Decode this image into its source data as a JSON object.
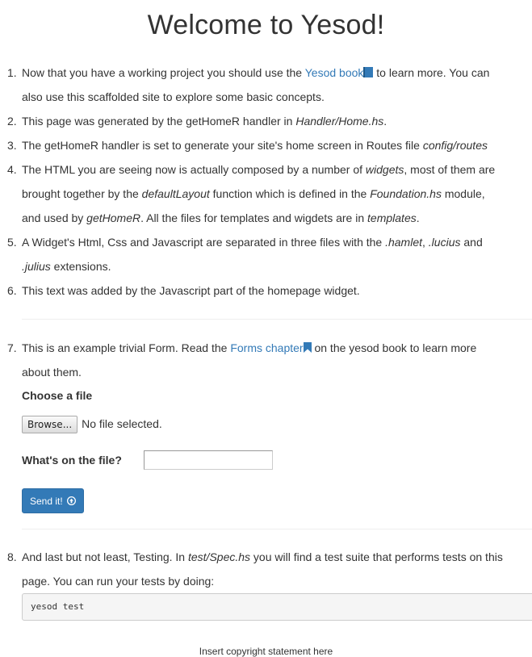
{
  "title": "Welcome to Yesod!",
  "items": [
    {
      "num": "1.",
      "t1": "Now that you have a working project you should use the ",
      "link": "Yesod book",
      "t2": " to learn more. You can",
      "t3": "also use this scaffolded site to explore some basic concepts."
    },
    {
      "num": "2.",
      "t1": "This page was generated by the getHomeR handler in ",
      "em1": "Handler/Home.hs",
      "t2": "."
    },
    {
      "num": "3.",
      "t1": "The getHomeR handler is set to generate your site's home screen in Routes file ",
      "em1": "config/routes"
    },
    {
      "num": "4.",
      "t1": "The HTML you are seeing now is actually composed by a number of ",
      "em1": "widgets",
      "t2": ", most of them are",
      "t3": "brought together by the ",
      "em2": "defaultLayout",
      "t4": " function which is defined in the ",
      "em3": "Foundation.hs",
      "t5": " module,",
      "t6": "and used by ",
      "em4": "getHomeR",
      "t7": ". All the files for templates and wigdets are in ",
      "em5": "templates",
      "t8": "."
    },
    {
      "num": "5.",
      "t1": "A Widget's Html, Css and Javascript are separated in three files with the ",
      "em1": ".hamlet",
      "t2": ", ",
      "em2": ".lucius",
      "t3": " and",
      "em3": ".julius",
      "t4": " extensions."
    },
    {
      "num": "6.",
      "t1": "This text was added by the Javascript part of the homepage widget."
    }
  ],
  "form": {
    "num": "7.",
    "t1": "This is an example trivial Form. Read the ",
    "link": "Forms chapter",
    "t2": " on the yesod book to learn more",
    "t3": "about them.",
    "file_label": "Choose a file",
    "browse_label": "Browse...",
    "nofile_text": "No file selected.",
    "text_label": "What's on the file?",
    "text_value": "",
    "submit_label": "Send it!"
  },
  "testing": {
    "num": "8.",
    "t1": "And last but not least, Testing. In ",
    "em1": "test/Spec.hs",
    "t2": " you will find a test suite that performs tests on this",
    "t3": "page. You can run your tests by doing:",
    "code": "yesod test"
  },
  "footer": "Insert copyright statement here",
  "colors": {
    "link": "#337ab7",
    "button": "#337ab7"
  },
  "icons": {
    "book": "book-icon",
    "bookmark": "bookmark-icon",
    "upload": "upload-circle-icon"
  }
}
